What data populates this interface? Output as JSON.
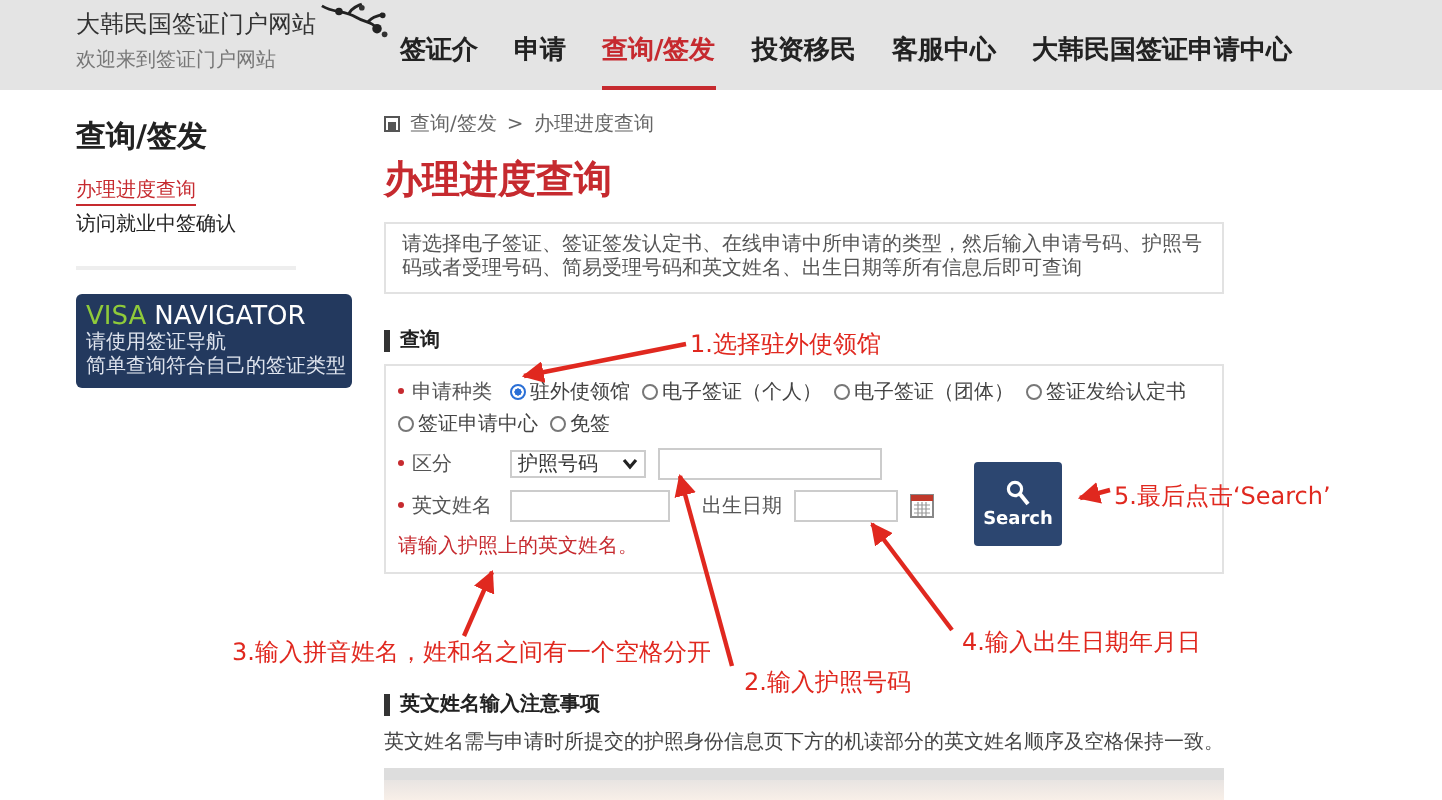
{
  "header": {
    "site_title": "大韩民国签证门户网站",
    "site_subtitle": "欢迎来到签证门户网站"
  },
  "nav": [
    {
      "label": "签证介",
      "selected": false
    },
    {
      "label": "申请",
      "selected": false
    },
    {
      "label": "查询/签发",
      "selected": true
    },
    {
      "label": "投资移民",
      "selected": false
    },
    {
      "label": "客服中心",
      "selected": false
    },
    {
      "label": "大韩民国签证申请中心",
      "selected": false
    }
  ],
  "sidebar": {
    "title": "查询/签发",
    "items": [
      {
        "label": "办理进度查询",
        "selected": true
      },
      {
        "label": "访问就业中签确认",
        "selected": false
      }
    ],
    "banner": {
      "title_1": "VISA",
      "title_2": "NAVIGATOR",
      "lines": [
        "请使用签证导航",
        "简单查询符合自己的签证类型"
      ]
    }
  },
  "breadcrumb": {
    "items": [
      "查询/签发",
      "办理进度查询"
    ],
    "separator": ">"
  },
  "page_title": "办理进度查询",
  "notice": "请选择电子签证、签证签发认定书、在线申请中所申请的类型，然后输入申请号码、护照号码或者受理号码、简易受理号码和英文姓名、出生日期等所有信息后即可查询",
  "query": {
    "heading": "查询",
    "type_label": "申请种类",
    "types": [
      {
        "label": "驻外使领馆",
        "selected": true
      },
      {
        "label": "电子签证（个人）",
        "selected": false
      },
      {
        "label": "电子签证（团体）",
        "selected": false
      },
      {
        "label": "签证发给认定书",
        "selected": false
      },
      {
        "label": "签证申请中心",
        "selected": false
      },
      {
        "label": "免签",
        "selected": false
      }
    ],
    "division_label": "区分",
    "division_value": "护照号码",
    "name_label": "英文姓名",
    "birth_label": "出生日期",
    "search_button": "Search",
    "hint": "请输入护照上的英文姓名。"
  },
  "name_notes": {
    "heading": "英文姓名输入注意事项",
    "text": "英文姓名需与申请时所提交的护照身份信息页下方的机读部分的英文姓名顺序及空格保持一致。"
  },
  "annotations": [
    {
      "text": "1.选择驻外使领馆"
    },
    {
      "text": "5.最后点击‘Search’"
    },
    {
      "text": "3.输入拼音姓名，姓和名之间有一个空格分开"
    },
    {
      "text": "4.输入出生日期年月日"
    },
    {
      "text": "2.输入护照号码"
    }
  ]
}
